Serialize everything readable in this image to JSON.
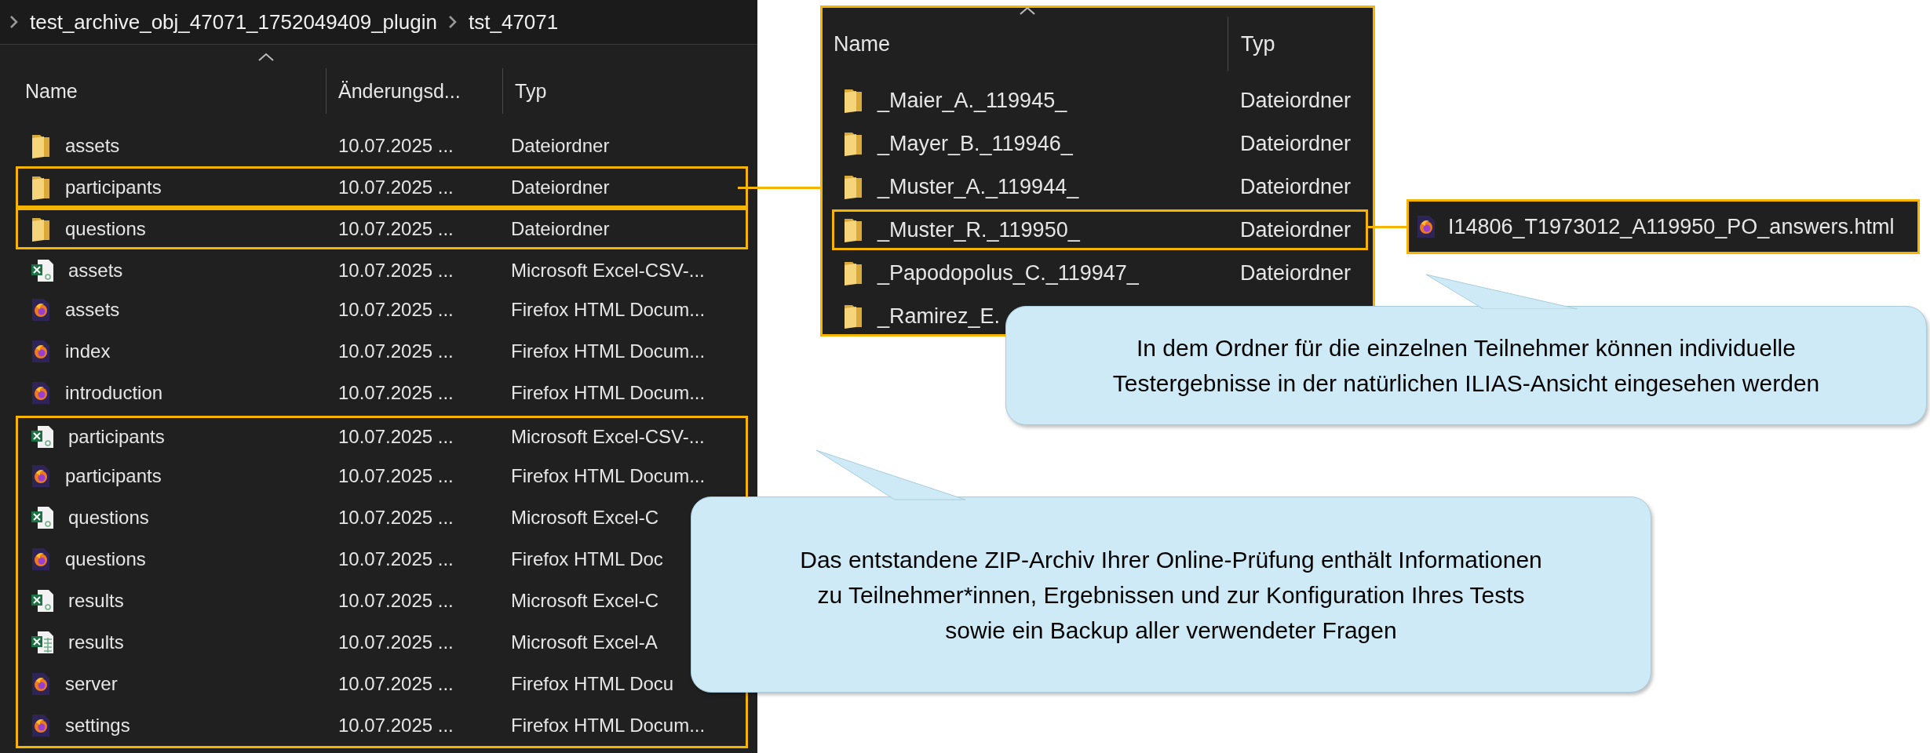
{
  "explorer": {
    "breadcrumb": [
      "test_archive_obj_47071_1752049409_plugin",
      "tst_47071"
    ],
    "columns": [
      "Name",
      "Änderungsd...",
      "Typ"
    ],
    "groups": [
      {
        "highlighted": false,
        "rows": [
          {
            "kind": "folder",
            "name": "assets",
            "date": "10.07.2025 ...",
            "type": "Dateiordner"
          }
        ]
      },
      {
        "highlighted": true,
        "rows": [
          {
            "kind": "folder",
            "name": "participants",
            "date": "10.07.2025 ...",
            "type": "Dateiordner"
          }
        ]
      },
      {
        "highlighted": true,
        "rows": [
          {
            "kind": "folder",
            "name": "questions",
            "date": "10.07.2025 ...",
            "type": "Dateiordner"
          }
        ]
      },
      {
        "highlighted": false,
        "rows": [
          {
            "kind": "csv",
            "name": "assets",
            "date": "10.07.2025 ...",
            "type": "Microsoft Excel-CSV-..."
          },
          {
            "kind": "html",
            "name": "assets",
            "date": "10.07.2025 ...",
            "type": "Firefox HTML Docum..."
          },
          {
            "kind": "html",
            "name": "index",
            "date": "10.07.2025 ...",
            "type": "Firefox HTML Docum..."
          },
          {
            "kind": "html",
            "name": "introduction",
            "date": "10.07.2025 ...",
            "type": "Firefox HTML Docum..."
          }
        ]
      },
      {
        "highlighted": true,
        "rows": [
          {
            "kind": "csv",
            "name": "participants",
            "date": "10.07.2025 ...",
            "type": "Microsoft Excel-CSV-..."
          },
          {
            "kind": "html",
            "name": "participants",
            "date": "10.07.2025 ...",
            "type": "Firefox HTML Docum..."
          },
          {
            "kind": "csv",
            "name": "questions",
            "date": "10.07.2025 ...",
            "type": "Microsoft Excel-C"
          },
          {
            "kind": "html",
            "name": "questions",
            "date": "10.07.2025 ...",
            "type": "Firefox HTML Doc"
          },
          {
            "kind": "csv",
            "name": "results",
            "date": "10.07.2025 ...",
            "type": "Microsoft Excel-C"
          },
          {
            "kind": "xlsx",
            "name": "results",
            "date": "10.07.2025 ...",
            "type": "Microsoft Excel-A"
          },
          {
            "kind": "html",
            "name": "server",
            "date": "10.07.2025 ...",
            "type": "Firefox HTML Docu"
          },
          {
            "kind": "html",
            "name": "settings",
            "date": "10.07.2025 ...",
            "type": "Firefox HTML Docum..."
          }
        ]
      }
    ]
  },
  "detail": {
    "columns": [
      "Name",
      "Typ"
    ],
    "rows": [
      {
        "kind": "folder",
        "name": "_Maier_A._119945_",
        "type": "Dateiordner",
        "highlighted": false
      },
      {
        "kind": "folder",
        "name": "_Mayer_B._119946_",
        "type": "Dateiordner",
        "highlighted": false
      },
      {
        "kind": "folder",
        "name": "_Muster_A._119944_",
        "type": "Dateiordner",
        "highlighted": false
      },
      {
        "kind": "folder",
        "name": "_Muster_R._119950_",
        "type": "Dateiordner",
        "highlighted": true
      },
      {
        "kind": "folder",
        "name": "_Papodopolus_C._119947_",
        "type": "Dateiordner",
        "highlighted": false
      },
      {
        "kind": "folder",
        "name": "_Ramirez_E.",
        "highlighted": false
      }
    ]
  },
  "file": {
    "kind": "html",
    "name": "I14806_T1973012_A119950_PO_answers.html"
  },
  "callouts": [
    {
      "lines": [
        "In dem Ordner für die einzelnen Teilnehmer können individuelle",
        "Testergebnisse in der natürlichen ILIAS-Ansicht eingesehen werden"
      ]
    },
    {
      "lines": [
        "Das entstandene ZIP-Archiv Ihrer Online-Prüfung enthält Informationen",
        "zu Teilnehmer*innen, Ergebnissen und zur Konfiguration Ihres Tests",
        "sowie ein Backup aller verwendeter Fragen"
      ]
    }
  ]
}
